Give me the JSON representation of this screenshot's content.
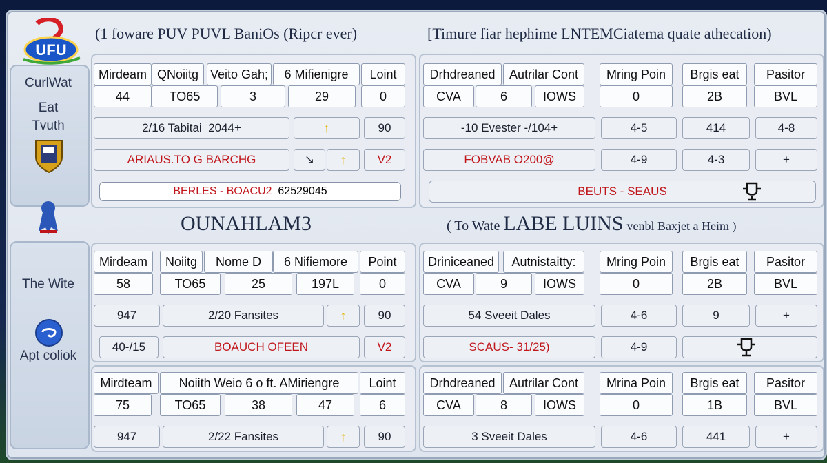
{
  "header": {
    "left_title": "(1 foware PUV PUVL BaniOs (Ripcr ever)",
    "right_title": "[Timure fiar hephime LNTEMCiatema quate athecation)"
  },
  "sidebar": {
    "logo_text": "UFU",
    "items": [
      {
        "label": "CurlWat"
      },
      {
        "label": "Eat"
      },
      {
        "label": "Tvuth"
      },
      {
        "label": "The Wite"
      },
      {
        "label": "Apt coliok"
      }
    ]
  },
  "section2": {
    "left_title": "OUNAHLAM3",
    "right_title_prefix": "( To Wate",
    "right_title_main": "LABE LUINS",
    "right_title_suffix": "venbl Baxjet a Heim )"
  },
  "top_left": {
    "headers": [
      "Mirdeam",
      "QNoiitg",
      "Veito Gah;",
      "6 Mifienigre",
      "Loint"
    ],
    "values": [
      "44",
      "TO65",
      "3",
      "29",
      "0"
    ],
    "bar1": {
      "left": "2/16 Tabitai",
      "mid": "2044+",
      "arrow": "↑",
      "right": "90"
    },
    "bar2": {
      "left": "ARIAUS.TO G BARCHG",
      "mid": "↘",
      "arrow": "↑",
      "right": "V2"
    },
    "input": {
      "text": "BERLES - BOACU2",
      "code": "62529045"
    }
  },
  "top_right": {
    "headers": [
      "Drhdreaned",
      "Autrilar Cont",
      "Mring Poin",
      "Brgis eat",
      "Pasitor"
    ],
    "values": [
      "CVA",
      "6",
      "IOWS",
      "0",
      "2B",
      "BVL"
    ],
    "bar1": {
      "left": "-10 Evester -/104+",
      "c1": "4-5",
      "c2": "414",
      "c3": "4-8"
    },
    "bar2": {
      "left": "FOBVAB O200@",
      "c1": "4-9",
      "c2": "4-3",
      "c3": "+"
    },
    "input": {
      "text": "BEUTS - SEAUS"
    }
  },
  "mid_left": {
    "headers": [
      "Mirdeam",
      "Noiitg",
      "Nome D",
      "6 Nifiemore",
      "Point"
    ],
    "values": [
      "58",
      "TO65",
      "25",
      "197L",
      "0"
    ],
    "bar1": {
      "left": "947",
      "mid": "2/20 Fansites",
      "arrow": "↑",
      "right": "90"
    },
    "bar2": {
      "left": "40-/15",
      "mid": "BOAUCH OFEEN",
      "right": "V2"
    }
  },
  "mid_right": {
    "headers": [
      "Driniceaned",
      "Autnistaitty:",
      "Mring Poin",
      "Brgis eat",
      "Pasitor"
    ],
    "values": [
      "CVA",
      "9",
      "IOWS",
      "0",
      "2B",
      "BVL"
    ],
    "bar1": {
      "left": "54 Sveeit Dales",
      "c1": "4-6",
      "c2": "9",
      "c3": "+"
    },
    "bar2": {
      "left": "SCAUS- 31/25)",
      "c1": "4-9"
    }
  },
  "bot_left": {
    "headers": [
      "Mirdteam",
      "Noiith Weio 6 o ft. AMiriengre",
      "",
      "",
      "Loint"
    ],
    "values": [
      "75",
      "TO65",
      "38",
      "47",
      "6"
    ],
    "bar1": {
      "left": "947",
      "mid": "2/22 Fansites",
      "arrow": "↑",
      "right": "90"
    }
  },
  "bot_right": {
    "headers": [
      "Drhdreaned",
      "Autrilar Cont",
      "Mrina Poin",
      "Brgis eat",
      "Pasitor"
    ],
    "values": [
      "CVA",
      "8",
      "IOWS",
      "0",
      "1B",
      "BVL"
    ],
    "bar1": {
      "left": "3 Sveeit Dales",
      "c1": "4-6",
      "c2": "441",
      "c3": "+"
    }
  }
}
